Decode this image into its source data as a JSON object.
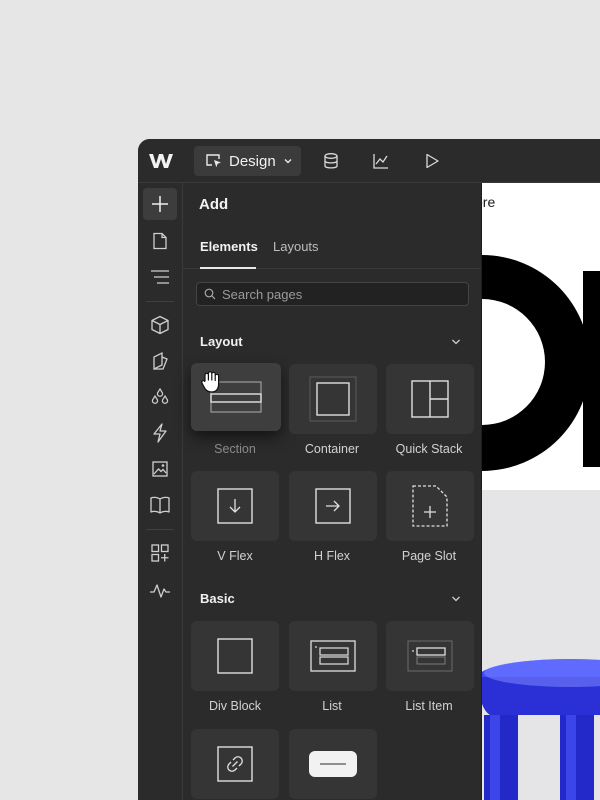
{
  "topbar": {
    "mode_label": "Design",
    "icons": [
      "webflow-logo",
      "cursor-box-icon",
      "chevron-down-icon",
      "database-icon",
      "analytics-icon",
      "play-icon"
    ]
  },
  "canvas": {
    "partial_text": "ore"
  },
  "rail": {
    "items": [
      "plus-icon",
      "page-icon",
      "navigator-icon",
      "box-icon",
      "style-icon",
      "drops-icon",
      "bolt-icon",
      "image-icon",
      "book-icon",
      "apps-icon",
      "pulse-icon"
    ],
    "active": "plus-icon"
  },
  "panel": {
    "title": "Add",
    "tabs": [
      {
        "label": "Elements",
        "active": true
      },
      {
        "label": "Layouts",
        "active": false
      }
    ],
    "search": {
      "placeholder": "Search pages",
      "value": ""
    },
    "sections": [
      {
        "label": "Layout",
        "items": [
          "Section",
          "Container",
          "Quick Stack",
          "V Flex",
          "H Flex",
          "Page Slot"
        ]
      },
      {
        "label": "Basic",
        "items": [
          "Div Block",
          "List",
          "List Item",
          "",
          ""
        ]
      }
    ]
  },
  "colors": {
    "app_bg": "#2b2b2b",
    "tile_bg": "#353535",
    "page_bg": "#e6e6e7",
    "accent_blue": "#2a2fd6"
  }
}
